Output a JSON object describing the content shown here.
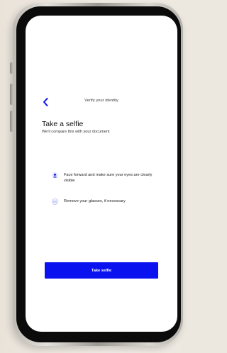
{
  "header": {
    "title": "Verify your identity",
    "back_icon": "chevron-left-icon"
  },
  "main": {
    "heading": "Take a selfie",
    "subheading": "We'll compare this with your document",
    "instructions": [
      {
        "icon": "face-icon",
        "text": "Face forward and make sure your eyes are clearly visible"
      },
      {
        "icon": "glasses-icon",
        "text": "Remove your glasses, if necessary"
      }
    ]
  },
  "footer": {
    "primary_button": "Take selfie"
  },
  "colors": {
    "accent": "#0a12f0",
    "icon_light": "#c9ccf8",
    "background": "#ffffff"
  }
}
